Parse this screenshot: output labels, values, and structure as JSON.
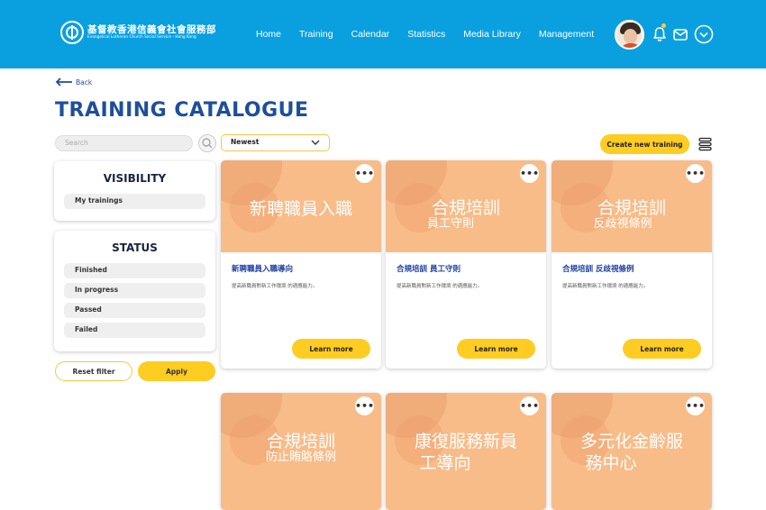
{
  "header": {
    "logo_zh": "基督教香港信義會社會服務部",
    "logo_en": "Evangelical Lutheran Church Social Service - Hong Kong",
    "nav": [
      "Home",
      "Training",
      "Calendar",
      "Statistics",
      "Media Library",
      "Management"
    ]
  },
  "back_label": "Back",
  "page_title": "TRAINING CATALOGUE",
  "search": {
    "placeholder": "Search"
  },
  "sort": {
    "value": "Newest"
  },
  "create_label": "Create new training",
  "visibility": {
    "title": "VISIBILITY",
    "items": [
      "My trainings"
    ]
  },
  "status": {
    "title": "STATUS",
    "items": [
      "Finished",
      "In progress",
      "Passed",
      "Failed"
    ]
  },
  "reset_label": "Reset filter",
  "apply_label": "Apply",
  "cards": [
    {
      "img_title": "新聘職員入職",
      "img_sub": "",
      "title": "新聘職員入職導向",
      "desc": "提高新職員對新工作環境 的適應能力。",
      "button": "Learn more"
    },
    {
      "img_title": "合規培訓",
      "img_sub": "員工守則",
      "title": "合規培訓  員工守則",
      "desc": "提高新職員對新工作環境 的適應能力。",
      "button": "Learn more"
    },
    {
      "img_title": "合規培訓",
      "img_sub": "反歧視條例",
      "title": "合規培訓  反歧視條例",
      "desc": "提高新職員對新工作環境 的適應能力。",
      "button": "Learn more"
    },
    {
      "img_title": "合規培訓",
      "img_sub": "防止賄賂條例",
      "title": "",
      "desc": "",
      "button": ""
    },
    {
      "img_title": "康復服務新員",
      "img_sub": "工導向",
      "title": "",
      "desc": "",
      "button": ""
    },
    {
      "img_title": "多元化金齡服",
      "img_sub": "務中心",
      "title": "",
      "desc": "",
      "button": ""
    }
  ],
  "colors": {
    "header": "#0aa0e0",
    "accent": "#ffcc22",
    "title": "#1e4f9a",
    "card_image": "#f8bc89"
  },
  "icons": [
    "search-icon",
    "chevron-down-icon",
    "list-view-icon",
    "bell-icon",
    "mail-icon",
    "chevron-circle-icon",
    "more-icon",
    "back-arrow-icon"
  ]
}
